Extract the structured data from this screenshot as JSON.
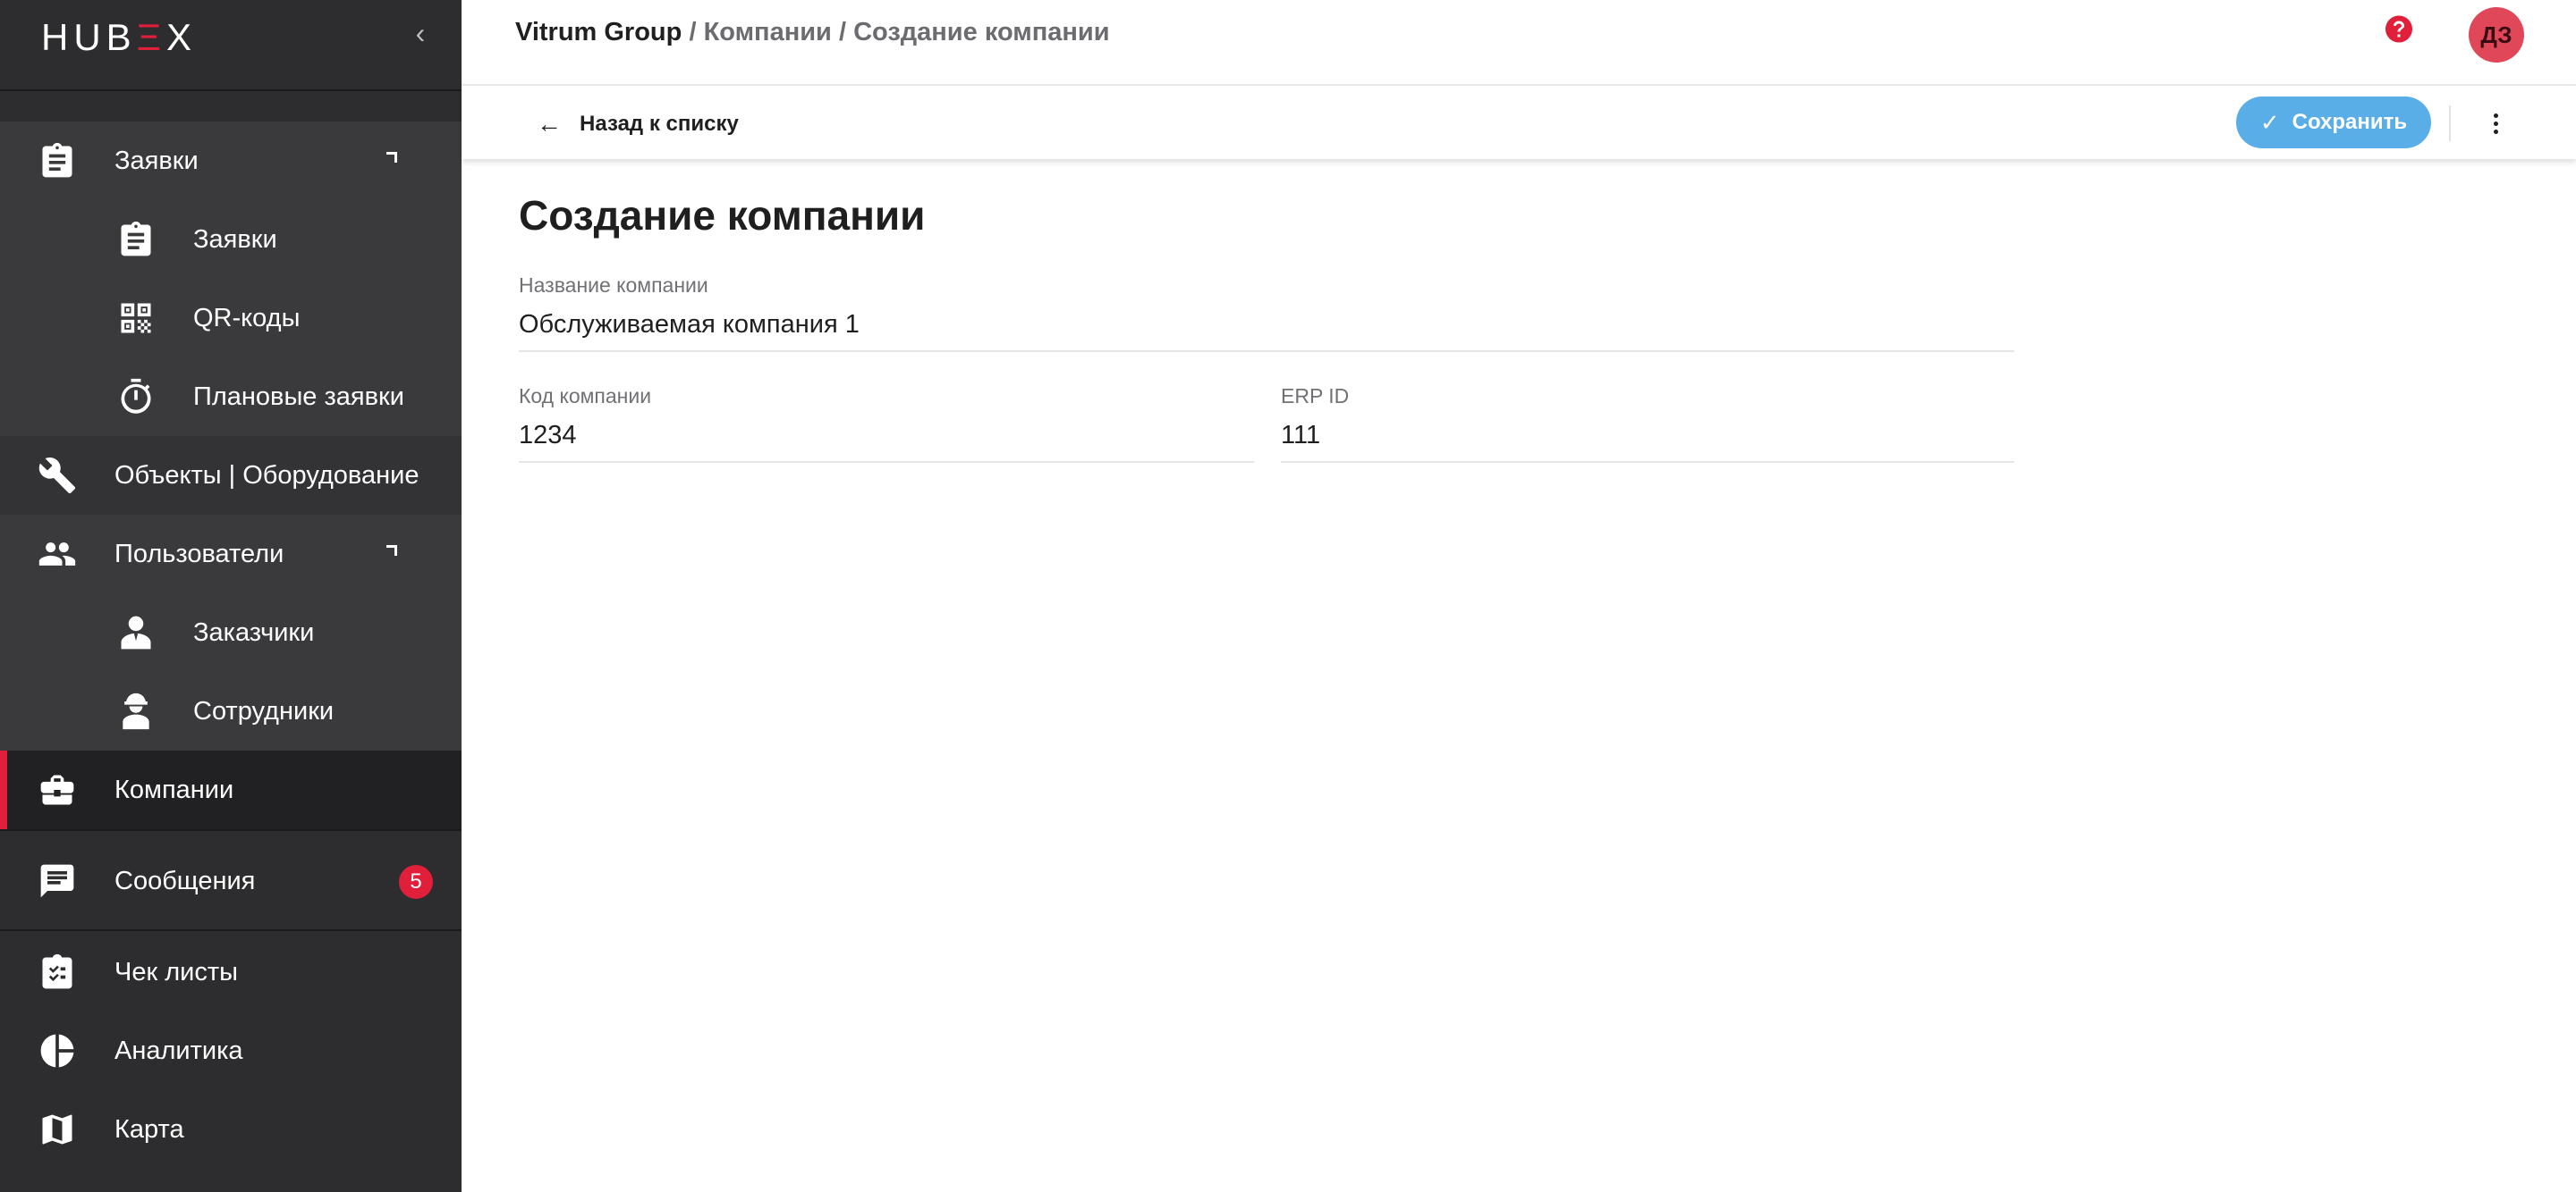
{
  "app": {
    "logo_prefix": "HUB",
    "logo_accent": "Ξ",
    "logo_suffix": "X"
  },
  "sidebar": {
    "collapse_icon": "chevron-left-icon",
    "items": [
      {
        "label": "Заявки",
        "icon": "clipboard-icon"
      },
      {
        "label": "Заявки",
        "icon": "clipboard-icon"
      },
      {
        "label": "QR-коды",
        "icon": "qr-code-icon"
      },
      {
        "label": "Плановые заявки",
        "icon": "timer-icon"
      },
      {
        "label": "Объекты | Оборудование",
        "icon": "wrench-icon"
      },
      {
        "label": "Пользователи",
        "icon": "users-icon"
      },
      {
        "label": "Заказчики",
        "icon": "customer-icon"
      },
      {
        "label": "Сотрудники",
        "icon": "worker-icon"
      },
      {
        "label": "Компании",
        "icon": "briefcase-icon"
      },
      {
        "label": "Сообщения",
        "icon": "message-icon",
        "badge": "5"
      },
      {
        "label": "Чек листы",
        "icon": "checklist-icon"
      },
      {
        "label": "Аналитика",
        "icon": "pie-chart-icon"
      },
      {
        "label": "Карта",
        "icon": "map-icon"
      }
    ]
  },
  "header": {
    "breadcrumb": {
      "root": "Vitrum Group",
      "separator": "/",
      "section": "Компании",
      "current": "Создание компании"
    },
    "avatar_initials": "ДЗ"
  },
  "actions": {
    "back_label": "Назад к списку",
    "save_label": "Сохранить"
  },
  "form": {
    "title": "Создание компании",
    "company_name": {
      "label": "Название компании",
      "value": "Обслуживаемая компания 1"
    },
    "company_code": {
      "label": "Код компании",
      "value": "1234"
    },
    "erp_id": {
      "label": "ERP ID",
      "value": "111"
    }
  },
  "colors": {
    "accent": "#e0203b",
    "primary": "#5aaee8",
    "sidebar_bg": "#2d2d2f",
    "sidebar_sub_bg": "#3a3a3d"
  }
}
